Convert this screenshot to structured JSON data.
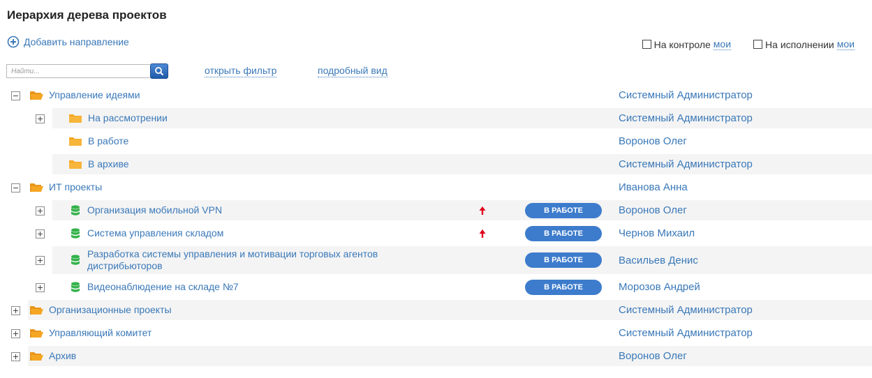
{
  "page": {
    "title": "Иерархия дерева проектов",
    "add_direction": "Добавить направление"
  },
  "filters": {
    "on_control": "На контроле",
    "on_control_link": "мои",
    "on_execution": "На исполнении",
    "on_execution_link": "мои"
  },
  "toolbar": {
    "search_placeholder": "Найти...",
    "open_filter": "открыть фильтр",
    "detailed_view": "подробный вид"
  },
  "tree": [
    {
      "label": "Управление идеями",
      "owner": "Системный Администратор",
      "level": 0,
      "kind": "folder-open",
      "toggle": "minus",
      "shaded": false
    },
    {
      "label": "На рассмотрении",
      "owner": "Системный Администратор",
      "level": 1,
      "kind": "folder",
      "toggle": "plus",
      "shaded": true
    },
    {
      "label": "В работе",
      "owner": "Воронов Олег",
      "level": 1,
      "kind": "folder",
      "toggle": "none",
      "shaded": false
    },
    {
      "label": "В архиве",
      "owner": "Системный Администратор",
      "level": 1,
      "kind": "folder",
      "toggle": "none",
      "shaded": true
    },
    {
      "label": "ИТ проекты",
      "owner": "Иванова Анна",
      "level": 0,
      "kind": "folder-open",
      "toggle": "minus",
      "shaded": false
    },
    {
      "label": "Организация мобильной VPN",
      "owner": "Воронов Олег",
      "level": 1,
      "kind": "project",
      "toggle": "plus",
      "shaded": true,
      "status": "В РАБОТЕ",
      "priority": true
    },
    {
      "label": "Система управления складом",
      "owner": "Чернов Михаил",
      "level": 1,
      "kind": "project",
      "toggle": "plus",
      "shaded": false,
      "status": "В РАБОТЕ",
      "priority": true
    },
    {
      "label": "Разработка системы управления и мотивации торговых агентов дистрибьюторов",
      "owner": "Васильев Денис",
      "level": 1,
      "kind": "project",
      "toggle": "plus",
      "shaded": true,
      "status": "В РАБОТЕ",
      "priority": false,
      "tall": true
    },
    {
      "label": "Видеонаблюдение на складе №7",
      "owner": "Морозов Андрей",
      "level": 1,
      "kind": "project",
      "toggle": "plus",
      "shaded": false,
      "status": "В РАБОТЕ",
      "priority": false
    },
    {
      "label": "Организационные проекты",
      "owner": "Системный Администратор",
      "level": 0,
      "kind": "folder-open",
      "toggle": "plus",
      "shaded": true
    },
    {
      "label": "Управляющий комитет",
      "owner": "Системный Администратор",
      "level": 0,
      "kind": "folder-open",
      "toggle": "plus",
      "shaded": false
    },
    {
      "label": "Архив",
      "owner": "Воронов Олег",
      "level": 0,
      "kind": "folder-open",
      "toggle": "plus",
      "shaded": true
    }
  ],
  "colors": {
    "link": "#3a78b8",
    "folder": "#f5a623",
    "project": "#33b24a",
    "badge": "#3d7ccc",
    "priority_arrow": "#e0001b",
    "row_shade": "#f4f4f4"
  },
  "icons": {
    "add": "plus-circle-icon",
    "search": "magnifier-icon",
    "open_folder": "folder-open-icon",
    "folder": "folder-icon",
    "project": "database-icon",
    "priority": "arrow-up-icon"
  }
}
